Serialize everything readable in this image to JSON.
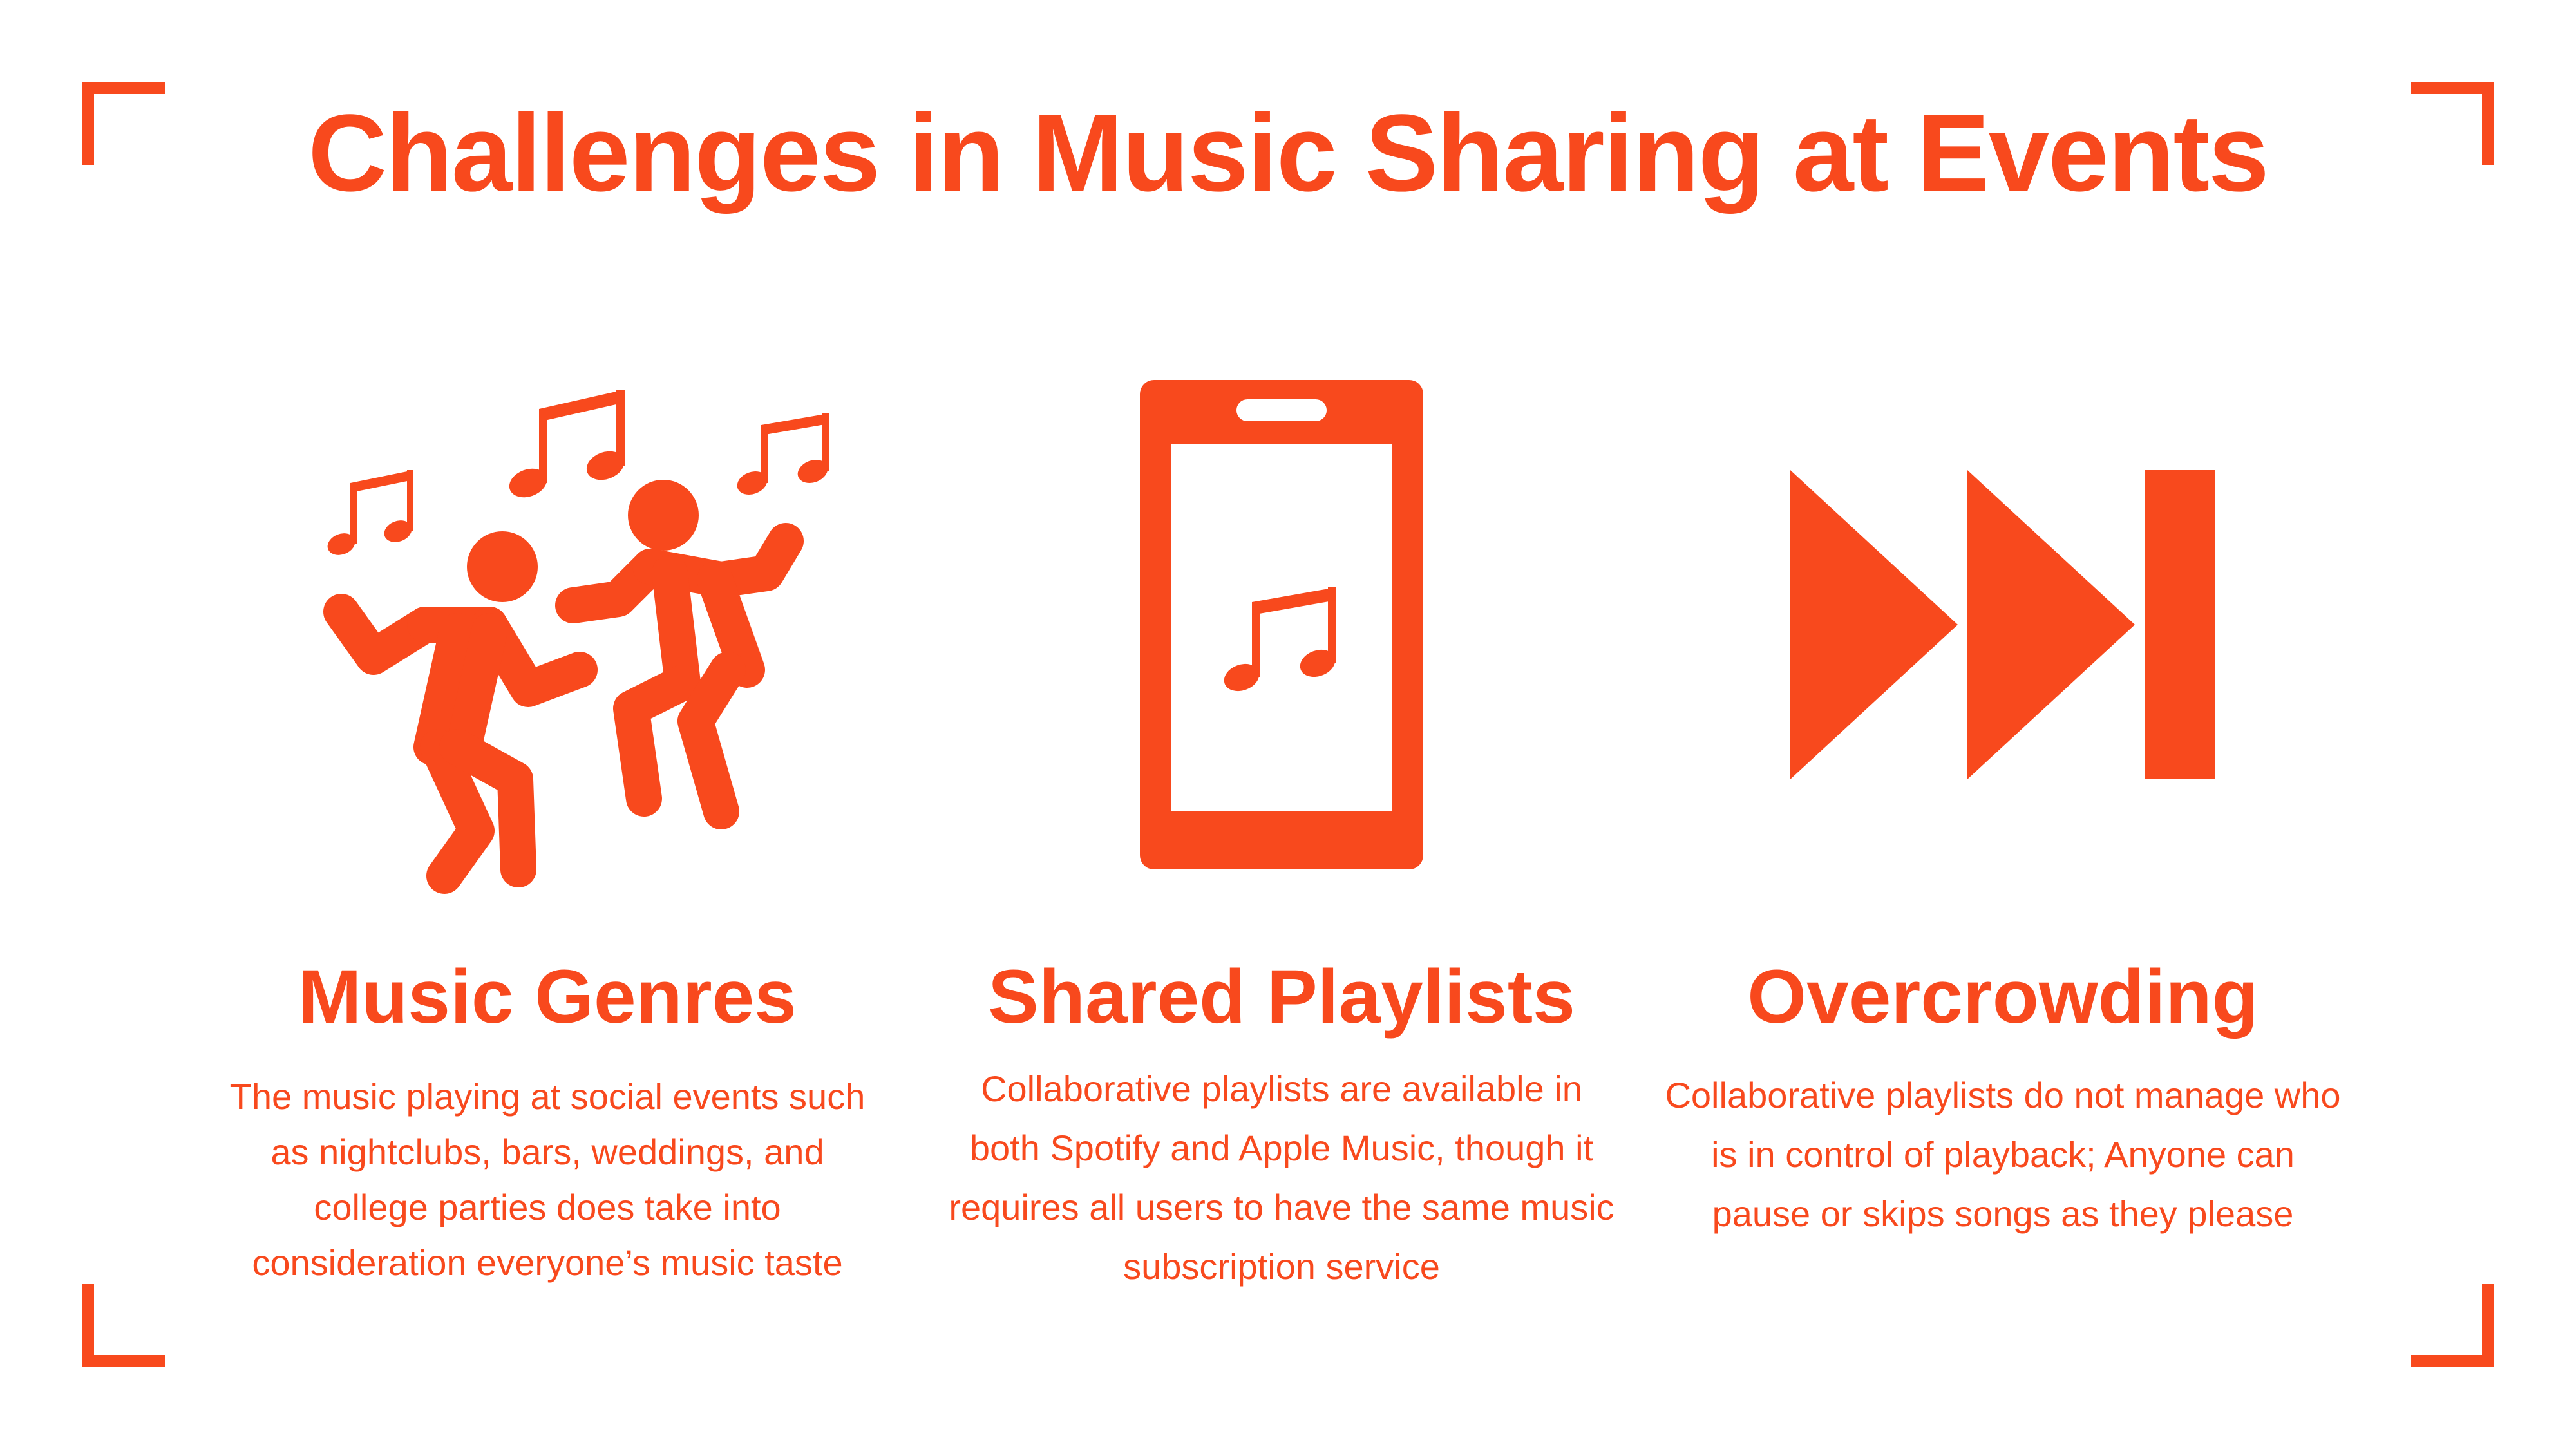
{
  "slide": {
    "title": "Challenges in Music Sharing at Events",
    "accent_color": "#f8491d",
    "columns": [
      {
        "icon": "dancing-people-music-notes-icon",
        "heading": "Music Genres",
        "body": "The music playing at social events such as nightclubs, bars, weddings, and college parties does take into consideration everyone’s music taste"
      },
      {
        "icon": "smartphone-music-note-icon",
        "heading": "Shared Playlists",
        "body": "Collaborative playlists are available in both Spotify and Apple Music, though it requires all users to have the same music subscription service"
      },
      {
        "icon": "skip-forward-icon",
        "heading": "Overcrowding",
        "body": "Collaborative playlists do not manage who is in control of playback; Anyone can pause or skips songs as they please"
      }
    ]
  }
}
